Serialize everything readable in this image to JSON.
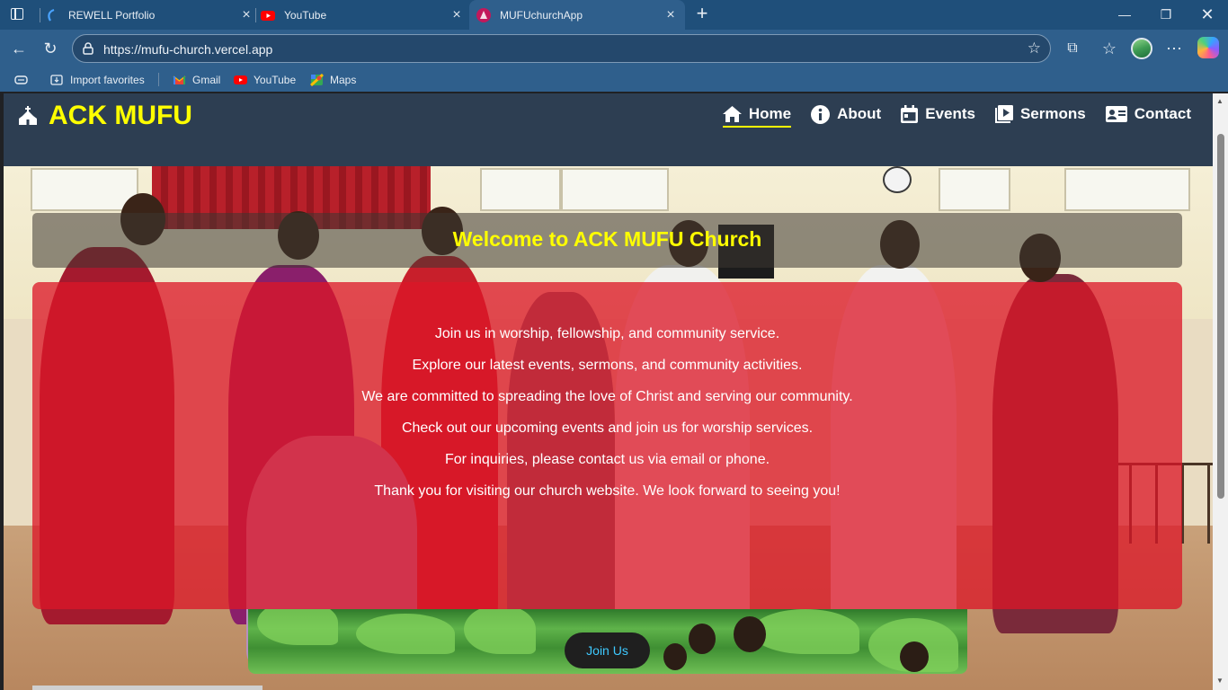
{
  "browser": {
    "tabs": [
      {
        "title": "REWELL Portfolio",
        "icon": "rewell-favicon"
      },
      {
        "title": "YouTube",
        "icon": "youtube-favicon"
      },
      {
        "title": "MUFUchurchApp",
        "icon": "mufu-favicon",
        "active": true
      }
    ],
    "address": "https://mufu-church.vercel.app",
    "favorites": [
      {
        "label": "Import favorites",
        "icon": "import-icon"
      },
      {
        "label": "Gmail",
        "icon": "gmail-icon"
      },
      {
        "label": "YouTube",
        "icon": "youtube-icon"
      },
      {
        "label": "Maps",
        "icon": "maps-icon"
      }
    ]
  },
  "site": {
    "brand": "ACK MUFU",
    "nav": [
      {
        "label": "Home",
        "icon": "home-icon",
        "active": true
      },
      {
        "label": "About",
        "icon": "info-icon"
      },
      {
        "label": "Events",
        "icon": "calendar-icon"
      },
      {
        "label": "Sermons",
        "icon": "play-icon"
      },
      {
        "label": "Contact",
        "icon": "contact-card-icon"
      }
    ],
    "welcome": "Welcome to ACK MUFU Church",
    "lines": [
      "Join us in worship, fellowship, and community service.",
      "Explore our latest events, sermons, and community activities.",
      "We are committed to spreading the love of Christ and serving our community.",
      "Check out our upcoming events and join us for worship services.",
      "For inquiries, please contact us via email or phone.",
      "Thank you for visiting our church website. We look forward to seeing you!"
    ],
    "join_label": "Join Us"
  },
  "colors": {
    "nav_bg": "#2d3e52",
    "brand": "#ffff00",
    "info_overlay": "#db1628",
    "join_text": "#3ec9ff"
  }
}
